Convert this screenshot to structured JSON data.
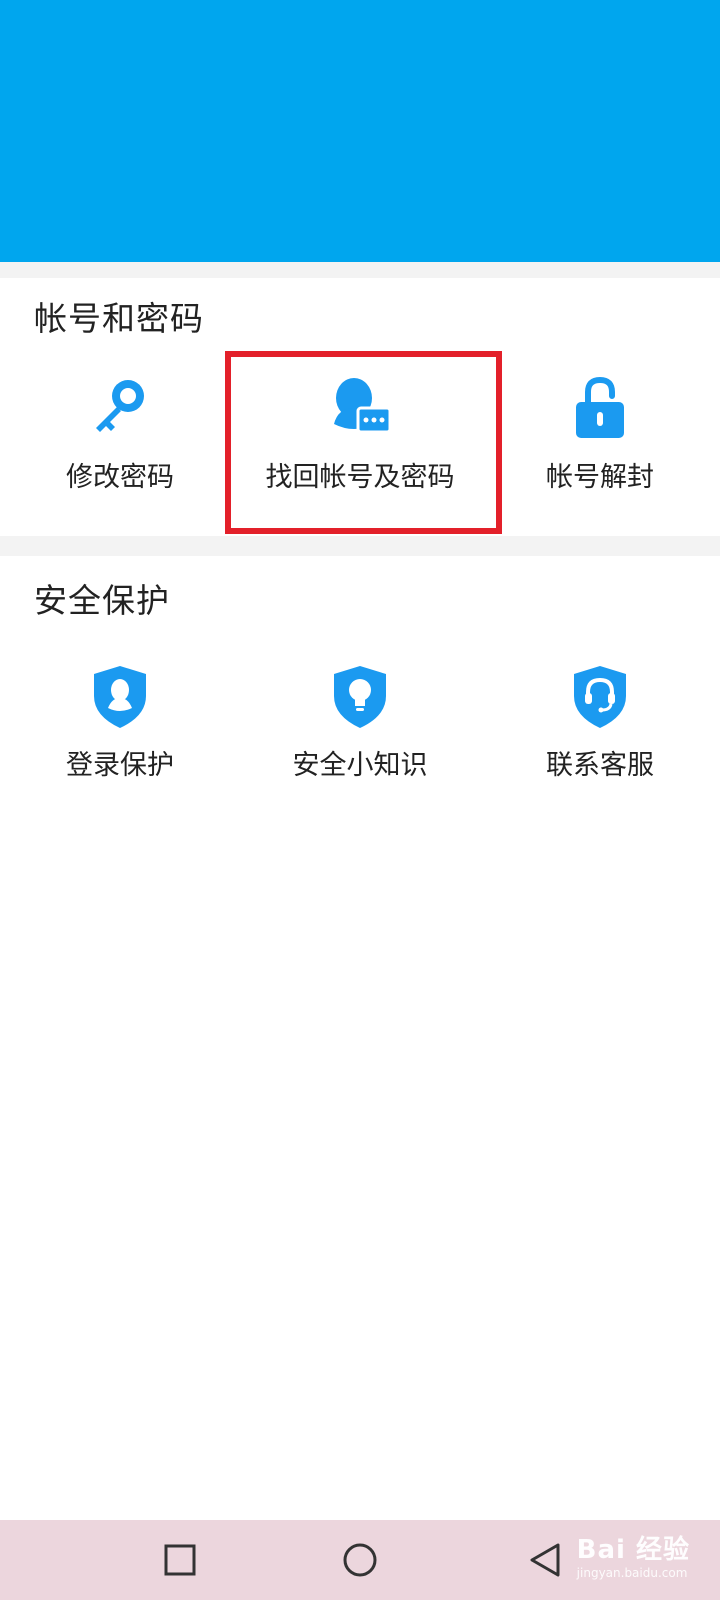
{
  "colors": {
    "header": "#00a6ee",
    "icon": "#1b9af0",
    "highlight": "#e3202a",
    "nav_bar": "#ecd6dd"
  },
  "sections": [
    {
      "title": "帐号和密码",
      "items": [
        {
          "label": "修改密码",
          "icon": "key-icon"
        },
        {
          "label": "找回帐号及密码",
          "icon": "qq-penguin-message-icon"
        },
        {
          "label": "帐号解封",
          "icon": "unlock-icon"
        }
      ]
    },
    {
      "title": "安全保护",
      "items": [
        {
          "label": "登录保护",
          "icon": "shield-penguin-icon"
        },
        {
          "label": "安全小知识",
          "icon": "shield-bulb-icon"
        },
        {
          "label": "联系客服",
          "icon": "shield-headset-icon"
        }
      ]
    }
  ],
  "nav": {
    "recent": "square-icon",
    "home": "circle-icon",
    "back": "triangle-back-icon"
  },
  "watermark": {
    "brand": "Bai 经验",
    "url": "jingyan.baidu.com"
  }
}
